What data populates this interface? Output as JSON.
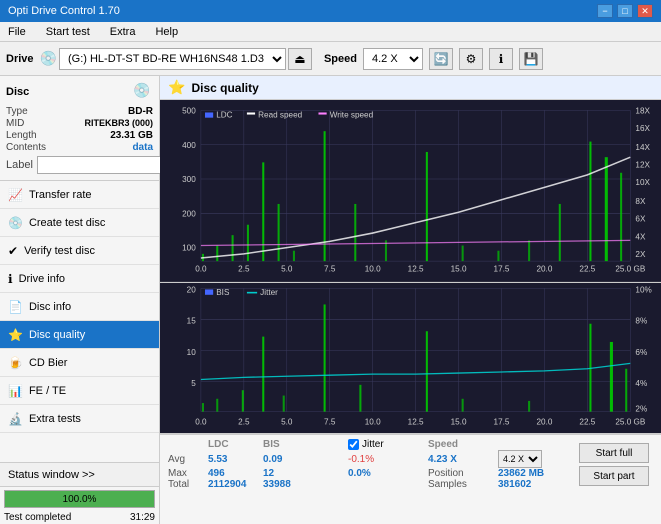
{
  "titleBar": {
    "title": "Opti Drive Control 1.70",
    "minimizeLabel": "−",
    "maximizeLabel": "□",
    "closeLabel": "✕"
  },
  "menuBar": {
    "items": [
      "File",
      "Start test",
      "Extra",
      "Help"
    ]
  },
  "toolbar": {
    "driveLabel": "Drive",
    "driveValue": "(G:)  HL-DT-ST BD-RE  WH16NS48 1.D3",
    "speedLabel": "Speed",
    "speedValue": "4.2 X"
  },
  "disc": {
    "title": "Disc",
    "type": {
      "key": "Type",
      "value": "BD-R"
    },
    "mid": {
      "key": "MID",
      "value": "RITEKBR3 (000)"
    },
    "length": {
      "key": "Length",
      "value": "23.31 GB"
    },
    "contents": {
      "key": "Contents",
      "value": "data"
    },
    "label": {
      "key": "Label",
      "value": ""
    }
  },
  "navItems": [
    {
      "id": "transfer-rate",
      "label": "Transfer rate",
      "icon": "📈"
    },
    {
      "id": "create-test-disc",
      "label": "Create test disc",
      "icon": "💿"
    },
    {
      "id": "verify-test-disc",
      "label": "Verify test disc",
      "icon": "✔"
    },
    {
      "id": "drive-info",
      "label": "Drive info",
      "icon": "ℹ"
    },
    {
      "id": "disc-info",
      "label": "Disc info",
      "icon": "📄"
    },
    {
      "id": "disc-quality",
      "label": "Disc quality",
      "icon": "⭐",
      "active": true
    },
    {
      "id": "cd-bier",
      "label": "CD Bier",
      "icon": "🍺"
    },
    {
      "id": "fe-te",
      "label": "FE / TE",
      "icon": "📊"
    },
    {
      "id": "extra-tests",
      "label": "Extra tests",
      "icon": "🔬"
    }
  ],
  "statusWindow": {
    "label": "Status window >>",
    "progress": 100,
    "progressText": "100.0%",
    "statusText": "Test completed",
    "time": "31:29"
  },
  "discQuality": {
    "title": "Disc quality",
    "legend": {
      "ldc": "LDC",
      "readSpeed": "Read speed",
      "writeSpeed": "Write speed",
      "bis": "BIS",
      "jitter": "Jitter"
    }
  },
  "chart1": {
    "yMax": 500,
    "yLabels": [
      "500",
      "400",
      "300",
      "200",
      "100"
    ],
    "yRight": [
      "18X",
      "16X",
      "14X",
      "12X",
      "10X",
      "8X",
      "6X",
      "4X",
      "2X"
    ],
    "xLabels": [
      "0.0",
      "2.5",
      "5.0",
      "7.5",
      "10.0",
      "12.5",
      "15.0",
      "17.5",
      "20.0",
      "22.5",
      "25.0 GB"
    ]
  },
  "chart2": {
    "yMax": 20,
    "yLabels": [
      "20",
      "15",
      "10",
      "5"
    ],
    "yRight": [
      "10%",
      "8%",
      "6%",
      "4%",
      "2%"
    ],
    "xLabels": [
      "0.0",
      "2.5",
      "5.0",
      "7.5",
      "10.0",
      "12.5",
      "15.0",
      "17.5",
      "20.0",
      "22.5",
      "25.0 GB"
    ]
  },
  "stats": {
    "headers": [
      "",
      "LDC",
      "BIS",
      "",
      "Jitter",
      "Speed",
      ""
    ],
    "avg": {
      "label": "Avg",
      "ldc": "5.53",
      "bis": "0.09",
      "jitter": "-0.1%",
      "speedLabel": "Position",
      "speedVal": "23862 MB"
    },
    "max": {
      "label": "Max",
      "ldc": "496",
      "bis": "12",
      "jitter": "0.0%",
      "posLabel": "Position"
    },
    "total": {
      "label": "Total",
      "ldc": "2112904",
      "bis": "33988",
      "samplesLabel": "Samples",
      "samplesVal": "381602"
    },
    "jitterChecked": true,
    "jitterLabel": "Jitter",
    "speed": "4.23 X",
    "speedSelectValue": "4.2 X",
    "startFullLabel": "Start full",
    "startPartLabel": "Start part"
  }
}
